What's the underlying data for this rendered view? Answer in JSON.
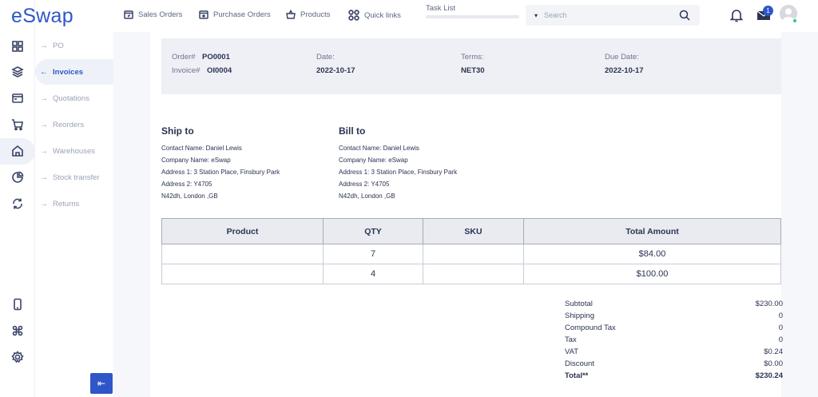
{
  "app": {
    "logo": "eSwap"
  },
  "rail": {
    "icons": [
      "grid-icon",
      "layers-icon",
      "card-icon",
      "cart-icon",
      "home-icon",
      "pie-chart-icon",
      "refresh-icon"
    ],
    "bottom_icons": [
      "mobile-icon",
      "command-icon",
      "settings-icon"
    ]
  },
  "submenu": {
    "items": [
      {
        "label": "PO",
        "active": false
      },
      {
        "label": "Invoices",
        "active": true
      },
      {
        "label": "Quotations",
        "active": false
      },
      {
        "label": "Reorders",
        "active": false
      },
      {
        "label": "Warehouses",
        "active": false
      },
      {
        "label": "Stock transfer",
        "active": false
      },
      {
        "label": "Returns",
        "active": false
      }
    ]
  },
  "topnav": {
    "sales_orders": "Sales Orders",
    "purchase_orders": "Purchase Orders",
    "products": "Products",
    "quick_links": "Quick links",
    "task_list": "Task List",
    "search_placeholder": "Search",
    "mail_count": "1"
  },
  "header": {
    "order_label": "Order#",
    "order_value": "PO0001",
    "invoice_label": "Invoice#",
    "invoice_value": "OI0004",
    "date_label": "Date:",
    "date_value": "2022-10-17",
    "terms_label": "Terms:",
    "terms_value": "NET30",
    "due_label": "Due Date:",
    "due_value": "2022-10-17"
  },
  "ship_to": {
    "title": "Ship to",
    "lines": [
      "Contact Name: Daniel Lewis",
      "Company Name: eSwap",
      "Address 1: 3 Station Place, Finsbury Park",
      "Address 2: Y4705",
      "N42dh, London ,GB"
    ]
  },
  "bill_to": {
    "title": "Bill to",
    "lines": [
      "Contact Name: Daniel Lewis",
      "Company Name: eSwap",
      "Address 1: 3 Station Place, Finsbury Park",
      "Address 2: Y4705",
      "N42dh, London ,GB"
    ]
  },
  "table": {
    "headers": [
      "Product",
      "QTY",
      "SKU",
      "Total Amount"
    ],
    "rows": [
      {
        "product": "",
        "qty": "7",
        "sku": "",
        "total": "$84.00"
      },
      {
        "product": "",
        "qty": "4",
        "sku": "",
        "total": "$100.00"
      }
    ]
  },
  "totals": [
    {
      "label": "Subtotal",
      "value": "$230.00",
      "bold": false
    },
    {
      "label": "Shipping",
      "value": "0",
      "bold": false
    },
    {
      "label": "Compound Tax",
      "value": "0",
      "bold": false
    },
    {
      "label": "Tax",
      "value": "0",
      "bold": false
    },
    {
      "label": "VAT",
      "value": "$0.24",
      "bold": false
    },
    {
      "label": "Discount",
      "value": "$0.00",
      "bold": false
    },
    {
      "label": "Total**",
      "value": "$230.24",
      "bold": true
    }
  ]
}
